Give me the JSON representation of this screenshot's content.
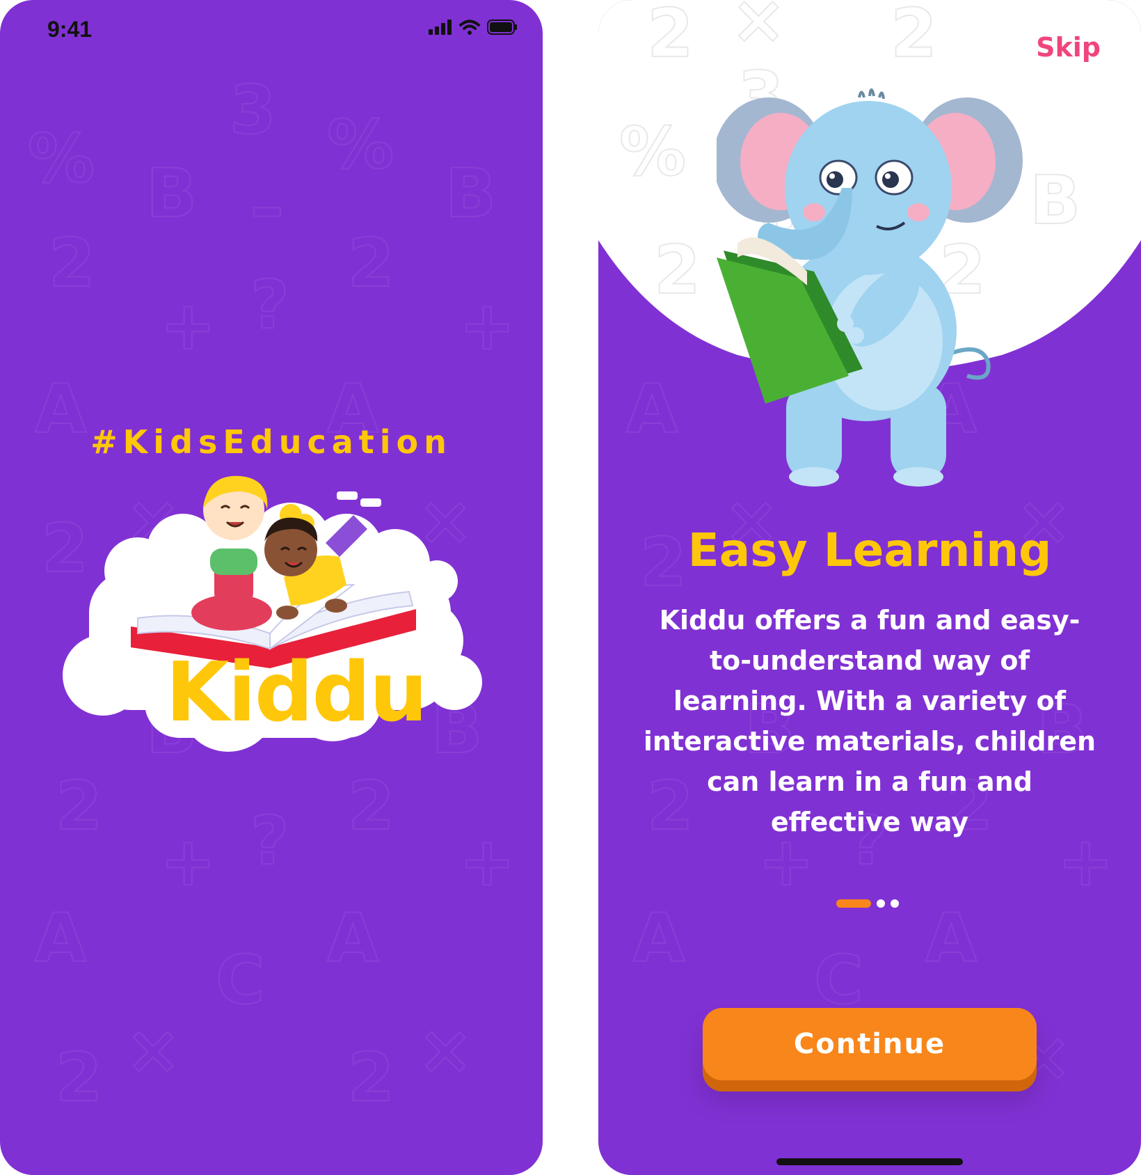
{
  "colors": {
    "background_purple": "#8031d3",
    "accent_yellow": "#ffc70a",
    "accent_orange": "#f8861b",
    "skip_pink": "#f0457c"
  },
  "splash": {
    "status_time": "9:41",
    "status_icons": [
      "signal-icon",
      "wifi-icon",
      "battery-icon"
    ],
    "hashtag": "#KidsEducation",
    "logo_text": "Kiddu"
  },
  "onboarding": {
    "skip_label": "Skip",
    "title": "Easy Learning",
    "body": "Kiddu offers a fun and easy-to-understand way of learning. With a variety of interactive materials, children can learn in a fun and effective way",
    "page_indicator": {
      "total": 3,
      "active": 1
    },
    "continue_label": "Continue"
  }
}
